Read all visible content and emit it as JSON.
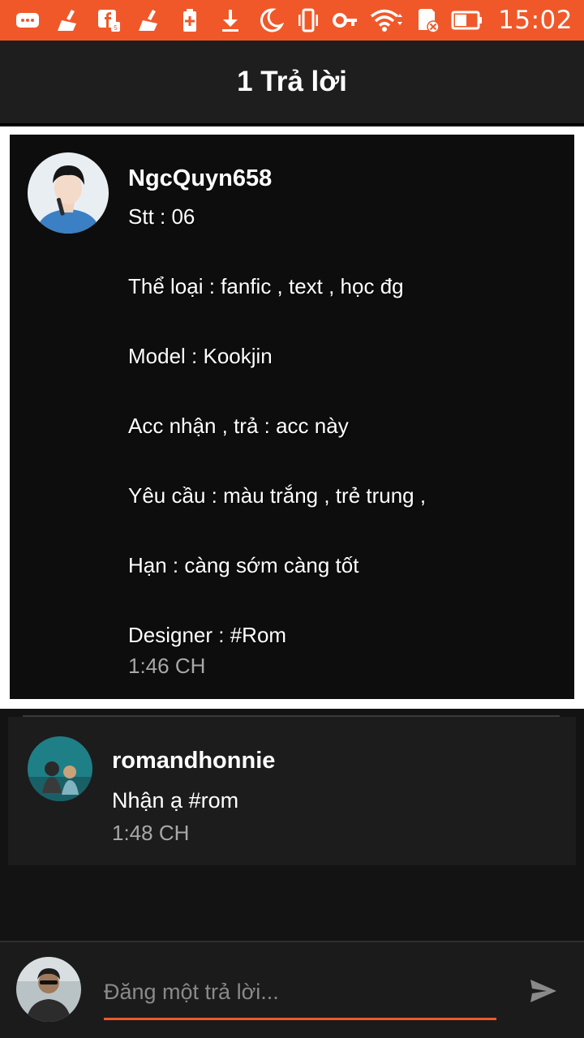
{
  "status_bar": {
    "time": "15:02",
    "icons": [
      "message-icon",
      "cleaner-icon",
      "facebook-icon",
      "cleaner-icon",
      "battery-saver-icon",
      "download-icon",
      "do-not-disturb-icon",
      "vibrate-icon",
      "vpn-key-icon",
      "wifi-icon",
      "sd-card-icon",
      "battery-icon"
    ]
  },
  "header": {
    "title": "1 Trả lời"
  },
  "post": {
    "username": "NgcQuyn658",
    "lines": [
      "Stt : 06",
      "",
      "Thể loại : fanfic , text , học đg",
      "",
      "Model : Kookjin",
      "",
      "Acc nhận , trả : acc này",
      "",
      "Yêu cầu : màu trắng , trẻ trung ,",
      "",
      "Hạn : càng sớm càng tốt",
      "",
      "Designer : #Rom"
    ],
    "time": "1:46 CH"
  },
  "reply": {
    "username": "romandhonnie",
    "text": "Nhận ạ #rom",
    "time": "1:48 CH"
  },
  "compose": {
    "placeholder": "Đăng một trả lời...",
    "value": ""
  },
  "colors": {
    "accent": "#f0582a",
    "background": "#131313",
    "header": "#1e1e1e",
    "muted_text": "#a8a8a8"
  }
}
